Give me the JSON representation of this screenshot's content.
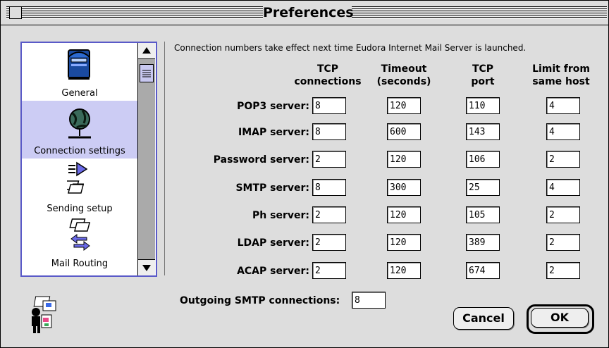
{
  "window": {
    "title": "Preferences"
  },
  "sidebar": {
    "items": [
      {
        "label": "General",
        "icon": "mailbox-icon",
        "selected": false
      },
      {
        "label": "Connection settings",
        "icon": "globe-network-icon",
        "selected": true
      },
      {
        "label": "Sending setup",
        "icon": "send-arrow-icon",
        "selected": false
      },
      {
        "label": "Mail Routing",
        "icon": "routing-arrows-icon",
        "selected": false
      }
    ]
  },
  "main": {
    "note": "Connection numbers take effect next time Eudora Internet Mail Server is launched.",
    "columns": [
      {
        "line1": "TCP",
        "line2": "connections"
      },
      {
        "line1": "Timeout",
        "line2": "(seconds)"
      },
      {
        "line1": "TCP",
        "line2": "port"
      },
      {
        "line1": "Limit from",
        "line2": "same host"
      }
    ],
    "rows": [
      {
        "label": "POP3 server:",
        "values": [
          "8",
          "120",
          "110",
          "4"
        ]
      },
      {
        "label": "IMAP server:",
        "values": [
          "8",
          "600",
          "143",
          "4"
        ]
      },
      {
        "label": "Password server:",
        "values": [
          "2",
          "120",
          "106",
          "2"
        ]
      },
      {
        "label": "SMTP server:",
        "values": [
          "8",
          "300",
          "25",
          "4"
        ]
      },
      {
        "label": "Ph server:",
        "values": [
          "2",
          "120",
          "105",
          "2"
        ]
      },
      {
        "label": "LDAP server:",
        "values": [
          "2",
          "120",
          "389",
          "2"
        ]
      },
      {
        "label": "ACAP server:",
        "values": [
          "2",
          "120",
          "674",
          "2"
        ]
      }
    ],
    "outgoing": {
      "label": "Outgoing SMTP connections:",
      "value": "8"
    }
  },
  "buttons": {
    "cancel": "Cancel",
    "ok": "OK"
  },
  "colors": {
    "selection": "#ccccf4",
    "listborder": "#5a5ac8",
    "window": "#dddddd"
  }
}
